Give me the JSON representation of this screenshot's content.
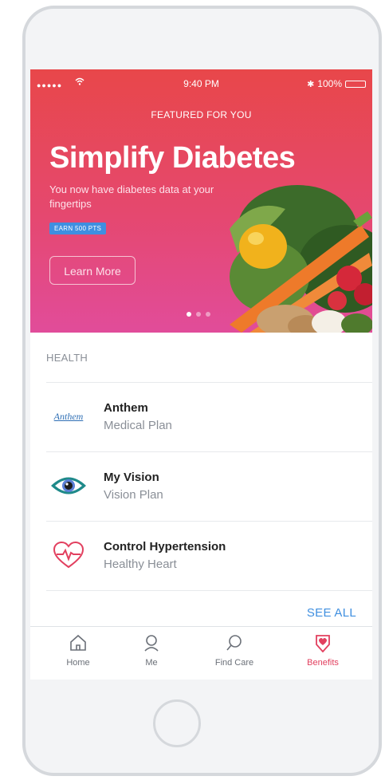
{
  "status_bar": {
    "signal": "●●●●●",
    "time": "9:40 PM",
    "battery": "100%"
  },
  "hero": {
    "featured_label": "FEATURED FOR YOU",
    "title": "Simplify Diabetes",
    "subtitle": "You now have diabetes data at your fingertips",
    "badge": "EARN 500 PTS",
    "button_label": "Learn More",
    "pager": {
      "count": 3,
      "active": 0
    }
  },
  "section": {
    "label": "HEALTH"
  },
  "list": [
    {
      "icon": "anthem-logo-icon",
      "logo_text": "Anthem",
      "title": "Anthem",
      "subtitle": "Medical Plan"
    },
    {
      "icon": "eye-icon",
      "title": "My Vision",
      "subtitle": "Vision Plan"
    },
    {
      "icon": "heart-pulse-icon",
      "title": "Control Hypertension",
      "subtitle": "Healthy Heart"
    }
  ],
  "see_all": "SEE ALL",
  "tabs": [
    {
      "icon": "house-icon",
      "label": "Home"
    },
    {
      "icon": "person-icon",
      "label": "Me"
    },
    {
      "icon": "search-icon",
      "label": "Find Care"
    },
    {
      "icon": "heart-badge-icon",
      "label": "Benefits",
      "active": true
    }
  ],
  "colors": {
    "accent": "#e2405f",
    "link": "#3f8fe0",
    "hero_top": "#e8474a",
    "hero_bottom": "#e14c9a"
  }
}
